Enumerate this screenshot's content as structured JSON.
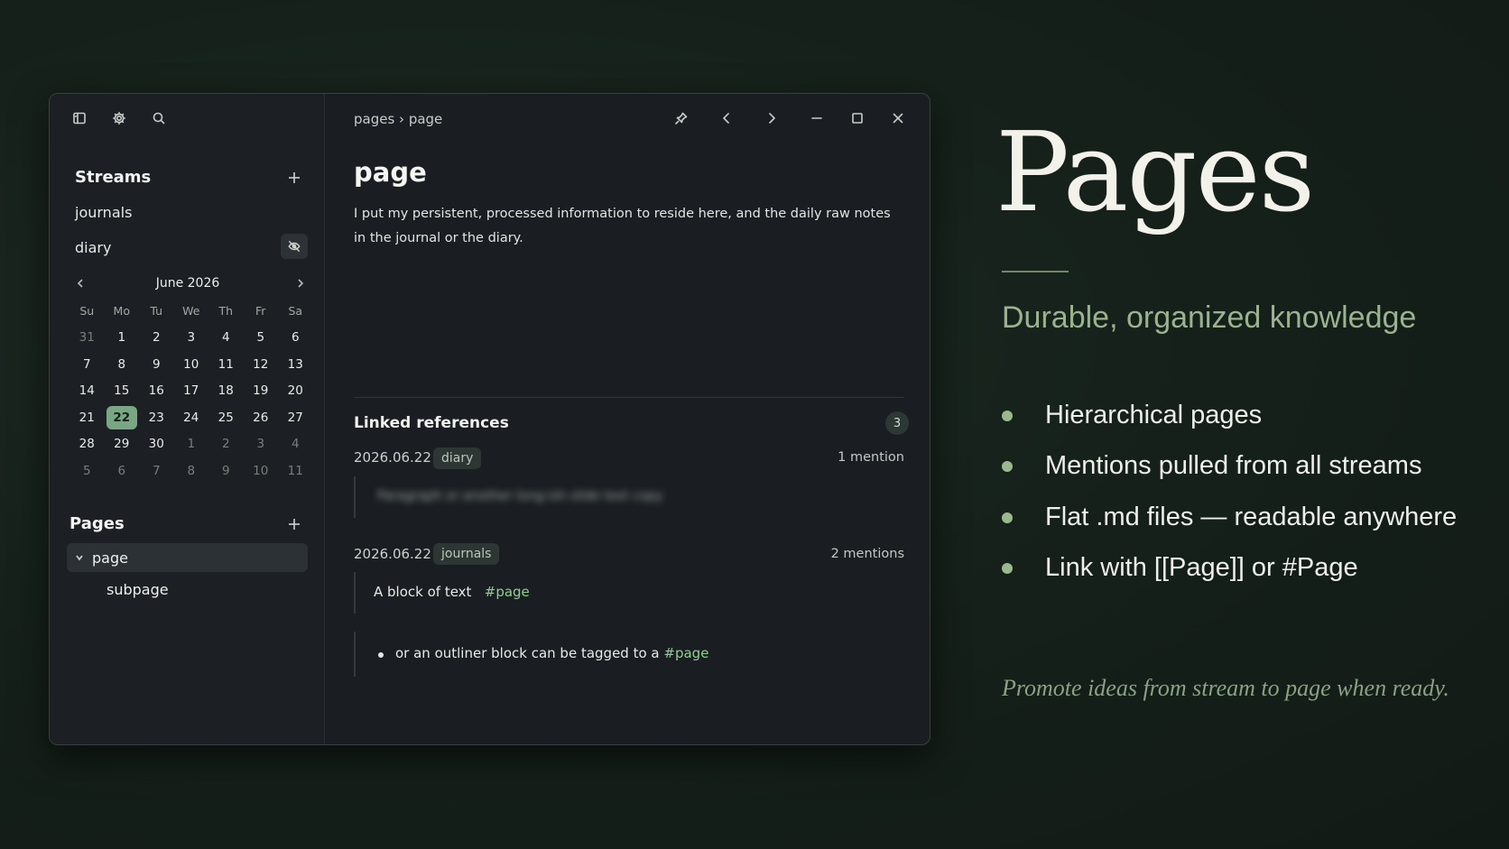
{
  "sidebar": {
    "streams_label": "Streams",
    "streams": [
      {
        "label": "journals"
      },
      {
        "label": "diary"
      }
    ],
    "calendar": {
      "month_label": "June 2026",
      "weekdays": [
        "Su",
        "Mo",
        "Tu",
        "We",
        "Th",
        "Fr",
        "Sa"
      ],
      "weeks": [
        [
          "31",
          "1",
          "2",
          "3",
          "4",
          "5",
          "6"
        ],
        [
          "7",
          "8",
          "9",
          "10",
          "11",
          "12",
          "13"
        ],
        [
          "14",
          "15",
          "16",
          "17",
          "18",
          "19",
          "20"
        ],
        [
          "21",
          "22",
          "23",
          "24",
          "25",
          "26",
          "27"
        ],
        [
          "28",
          "29",
          "30",
          "1",
          "2",
          "3",
          "4"
        ],
        [
          "5",
          "6",
          "7",
          "8",
          "9",
          "10",
          "11"
        ]
      ],
      "selected_day": "22"
    },
    "pages_label": "Pages",
    "pages": [
      {
        "label": "page",
        "expanded": true,
        "selected": true
      },
      {
        "label": "subpage"
      }
    ]
  },
  "main": {
    "breadcrumb": "pages › page",
    "title": "page",
    "body": "I put my persistent, processed information to reside here, and the daily raw notes in the journal or the diary.",
    "linked_refs": {
      "label": "Linked references",
      "count": "3",
      "groups": [
        {
          "date": "2026.06.22",
          "tag": "diary",
          "mentions": "1 mention",
          "blurred_text": "Paragraph or another long-ish slide text copy"
        },
        {
          "date": "2026.06.22",
          "tag": "journals",
          "mentions": "2 mentions",
          "block_text": "A block of text",
          "block_tag": "#page",
          "outline_text": "or an outliner block can be tagged to a",
          "outline_tag": "#page"
        }
      ]
    }
  },
  "promo": {
    "title": "Pages",
    "subtitle": "Durable, organized knowledge",
    "features": [
      "Hierarchical pages",
      "Mentions pulled from all streams",
      "Flat .md files — readable anywhere",
      "Link with [[Page]] or #Page"
    ],
    "footer": "Promote ideas from stream to page when ready."
  },
  "colors": {
    "accent": "#7aa783",
    "hashtag": "#8fcf8e",
    "promo_sub": "#9bb28f"
  }
}
